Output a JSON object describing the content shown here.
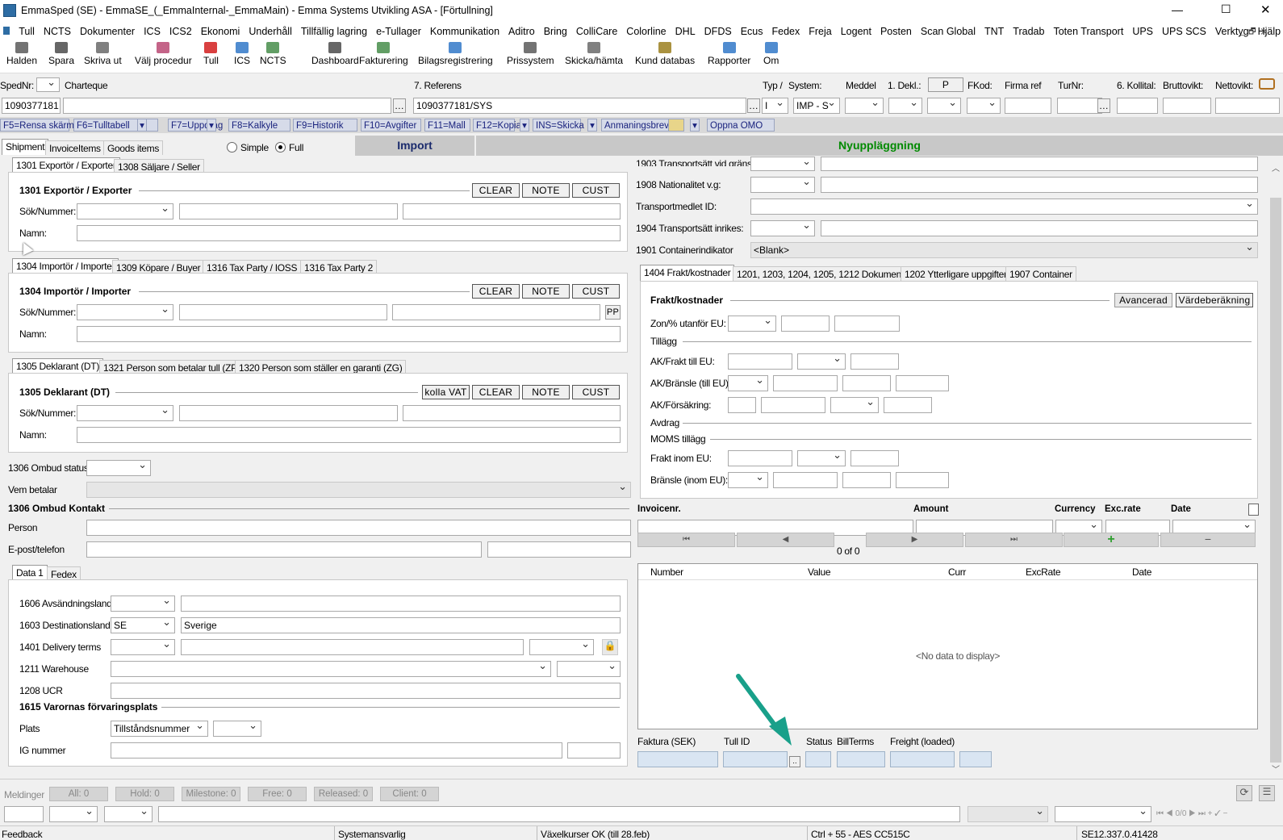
{
  "window": {
    "title": "EmmaSped (SE) - EmmaSE_(_EmmaInternal-_EmmaMain) - Emma Systems Utvikling ASA - [Förtullning]",
    "min": "—",
    "max": "☐",
    "close": "✕"
  },
  "menu": [
    "Tull",
    "NCTS",
    "Dokumenter",
    "ICS",
    "ICS2",
    "Ekonomi",
    "Underhåll",
    "Tillfällig lagring",
    "e-Tullager",
    "Kommunikation",
    "Aditro",
    "Bring",
    "ColliCare",
    "Colorline",
    "DHL",
    "DFDS",
    "Ecus",
    "Fedex",
    "Freja",
    "Logent",
    "Posten",
    "Scan Global",
    "TNT",
    "Tradab",
    "Toten Transport",
    "UPS",
    "UPS SCS",
    "Verktyg",
    "Hjälp"
  ],
  "toolbar": [
    {
      "label": "Halden",
      "icon": "truck-icon",
      "color": "#444"
    },
    {
      "label": "Spara",
      "icon": "save-icon",
      "color": "#333"
    },
    {
      "label": "Skriva ut",
      "icon": "print-icon",
      "color": "#555"
    },
    {
      "label": "Välj procedur",
      "icon": "abc-icon",
      "color": "#b03060"
    },
    {
      "label": "Tull",
      "icon": "tull-icon",
      "color": "#c00"
    },
    {
      "label": "ICS",
      "icon": "ics-icon",
      "color": "#1565c0"
    },
    {
      "label": "NCTS",
      "icon": "ncts-icon",
      "color": "#2e7d32"
    },
    {
      "label": "Dashboard",
      "icon": "dashboard-icon",
      "color": "#333"
    },
    {
      "label": "Fakturering",
      "icon": "invoice-icon",
      "color": "#2e7d32"
    },
    {
      "label": "Bilagsregistrering",
      "icon": "document-icon",
      "color": "#1565c0"
    },
    {
      "label": "Prissystem",
      "icon": "calculator-icon",
      "color": "#444"
    },
    {
      "label": "Skicka/hämta",
      "icon": "send-receive-icon",
      "color": "#555"
    },
    {
      "label": "Kund databas",
      "icon": "customers-icon",
      "color": "#8d6e00"
    },
    {
      "label": "Rapporter",
      "icon": "report-icon",
      "color": "#1565c0"
    },
    {
      "label": "Om",
      "icon": "sweden-flag-icon",
      "color": "#1565c0"
    }
  ],
  "header": {
    "spednr_label": "SpedNr:",
    "spednr": "1090377181",
    "charteque_label": "Charteque",
    "ref_label": "7. Referens",
    "ref": "1090377181/SYS",
    "typ_label": "Typ /",
    "system_label": "System:",
    "typ": "I",
    "system": "IMP - S",
    "meddel_label": "Meddel",
    "dekl_label": "1. Dekl.:",
    "p_label": "P",
    "fkod_label": "FKod:",
    "firma_label": "Firma ref",
    "turnr_label": "TurNr:",
    "kollital_label": "6. Kollital:",
    "brutto_label": "Bruttovikt:",
    "netto_label": "Nettovikt:"
  },
  "fkeys": [
    "F5=Rensa skärm",
    "F6=Tulltabell",
    "F7=Uppdrag",
    "F8=Kalkyle",
    "F9=Historik",
    "F10=Avgifter",
    "F11=Mall",
    "F12=Kopia",
    "INS=Skicka",
    "Anmaningsbrev",
    "Oppna OMO"
  ],
  "tabs": {
    "shipment": "Shipment",
    "invoice": "InvoiceItems",
    "goods": "Goods items",
    "simple": "Simple",
    "full": "Full",
    "import": "Import",
    "status": "Nyuppläggning"
  },
  "left": {
    "exp_tabs": [
      "1301 Exportör / Exporter",
      "1308 Säljare / Seller"
    ],
    "exp_title": "1301 Exportör / Exporter",
    "imp_tabs": [
      "1304 Importör / Importer",
      "1309 Köpare / Buyer",
      "1316 Tax Party / IOSS",
      "1316 Tax Party 2"
    ],
    "imp_title": "1304 Importör / Importer",
    "dek_tabs": [
      "1305 Deklarant (DT)",
      "1321 Person som betalar tull (ZP)",
      "1320 Person som ställer en garanti (ZG)"
    ],
    "dek_title": "1305 Deklarant (DT)",
    "sok": "Sök/Nummer:",
    "namn": "Namn:",
    "clear": "CLEAR",
    "note": "NOTE",
    "cust": "CUST",
    "kolla": "kolla VAT",
    "pp": "PP",
    "ombud_status": "1306 Ombud status",
    "vem": "Vem betalar",
    "ombud_kontakt": "1306 Ombud Kontakt",
    "person": "Person",
    "epost": "E-post/telefon",
    "data_tabs": [
      "Data 1",
      "Fedex"
    ],
    "avs": "1606 Avsändningsland",
    "dest": "1603 Destinationsland",
    "dest_code": "SE",
    "dest_name": "Sverige",
    "delivery": "1401 Delivery terms",
    "warehouse": "1211 Warehouse",
    "ucr": "1208 UCR",
    "varor": "1615 Varornas förvaringsplats",
    "plats": "Plats",
    "plats_val": "Tillståndsnummer",
    "ig": "IG nummer"
  },
  "right": {
    "t1903": "1903 Transportsätt vid gräns.",
    "t1908": "1908 Nationalitet v.g:",
    "tid": "Transportmedlet ID:",
    "t1904": "1904 Transportsätt inrikes:",
    "t1901": "1901 Containerindikator",
    "blank": "<Blank>",
    "tabs": [
      "1404 Frakt/kostnader",
      "1201, 1203, 1204, 1205, 1212 Dokument",
      "1202 Ytterligare uppgifter",
      "1907 Container"
    ],
    "frakt": "Frakt/kostnader",
    "avancerad": "Avancerad",
    "varde": "Värdeberäkning",
    "zon": "Zon/% utanför EU:",
    "tillagg": "Tillägg",
    "ak_frakt": "AK/Frakt till EU:",
    "ak_bransle": "AK/Bränsle (till EU)",
    "ak_fors": "AK/Försäkring:",
    "avdrag": "Avdrag",
    "moms": "MOMS tillägg",
    "frakt_inom": "Frakt inom EU:",
    "bransle_inom": "Bränsle (inom EU):",
    "inv_headers": [
      "Invoicenr.",
      "Amount",
      "Currency",
      "Exc.rate",
      "Date"
    ],
    "nav_count": "0 of 0",
    "grid_headers": [
      "Number",
      "Value",
      "Curr",
      "ExcRate",
      "Date"
    ],
    "no_data": "<No data to display>",
    "bottom": [
      "Faktura (SEK)",
      "Tull ID",
      "Status",
      "BillTerms",
      "Freight (loaded)"
    ]
  },
  "messages": {
    "label": "Meldinger",
    "all": "All: 0",
    "hold": "Hold: 0",
    "milestone": "Milestone: 0",
    "free": "Free: 0",
    "released": "Released: 0",
    "client": "Client: 0",
    "count": "0/0"
  },
  "statusbar": [
    "Feedback",
    "Systemansvarlig",
    "Växelkurser OK (till 28.feb)",
    "Ctrl + 55 - AES CC515C",
    "SE12.337.0.41428"
  ]
}
